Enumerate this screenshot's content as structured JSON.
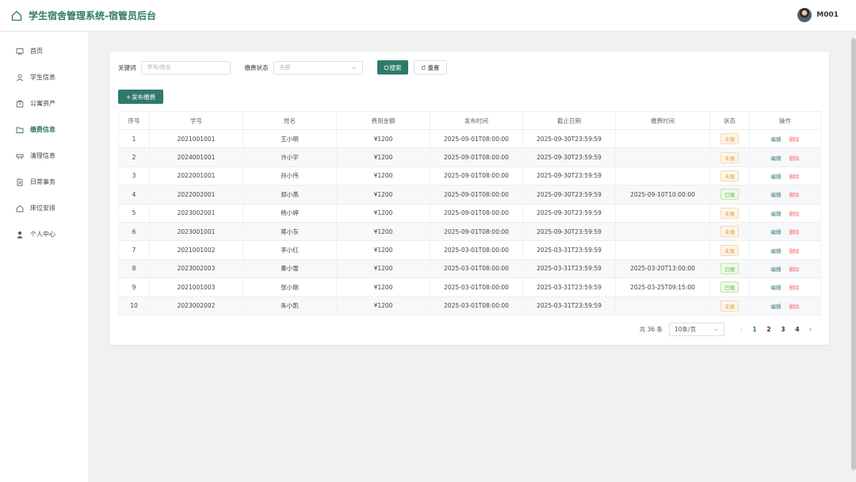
{
  "header": {
    "title": "学生宿舍管理系统-宿管员后台",
    "username": "M001"
  },
  "sidebar": {
    "items": [
      {
        "label": "首页",
        "icon": "home-board-icon"
      },
      {
        "label": "学生信息",
        "icon": "user-icon"
      },
      {
        "label": "公寓资产",
        "icon": "box-icon"
      },
      {
        "label": "缴费信息",
        "icon": "folder-icon",
        "active": true
      },
      {
        "label": "清理信息",
        "icon": "clean-icon"
      },
      {
        "label": "日常事务",
        "icon": "document-icon"
      },
      {
        "label": "床位安排",
        "icon": "house-icon"
      },
      {
        "label": "个人中心",
        "icon": "person-icon"
      }
    ]
  },
  "filters": {
    "keyword_label": "关键词",
    "keyword_placeholder": "学号/姓名",
    "status_label": "缴费状态",
    "status_value": "全部",
    "search_label": "搜索",
    "reset_label": "重置"
  },
  "add_button": "发布缴费",
  "table": {
    "headers": [
      "序号",
      "学号",
      "姓名",
      "费用金额",
      "发布时间",
      "截止日期",
      "缴费时间",
      "状态",
      "操作"
    ],
    "edit_label": "编辑",
    "delete_label": "删除",
    "rows": [
      {
        "no": "1",
        "sid": "2021001001",
        "name": "王小明",
        "amount": "¥1200",
        "published": "2025-09-01T08:00:00",
        "deadline": "2025-09-30T23:59:59",
        "paid_at": "",
        "status": "未缴",
        "paid": false
      },
      {
        "no": "2",
        "sid": "2024001001",
        "name": "许小宇",
        "amount": "¥1200",
        "published": "2025-09-01T08:00:00",
        "deadline": "2025-09-30T23:59:59",
        "paid_at": "",
        "status": "未缴",
        "paid": false
      },
      {
        "no": "3",
        "sid": "2022001001",
        "name": "孙小伟",
        "amount": "¥1200",
        "published": "2025-09-01T08:00:00",
        "deadline": "2025-09-30T23:59:59",
        "paid_at": "",
        "status": "未缴",
        "paid": false
      },
      {
        "no": "4",
        "sid": "2022002001",
        "name": "郑小燕",
        "amount": "¥1200",
        "published": "2025-09-01T08:00:00",
        "deadline": "2025-09-30T23:59:59",
        "paid_at": "2025-09-10T10:00:00",
        "status": "已缴",
        "paid": true
      },
      {
        "no": "5",
        "sid": "2023002001",
        "name": "杨小婷",
        "amount": "¥1200",
        "published": "2025-09-01T08:00:00",
        "deadline": "2025-09-30T23:59:59",
        "paid_at": "",
        "status": "未缴",
        "paid": false
      },
      {
        "no": "6",
        "sid": "2023001001",
        "name": "蒋小东",
        "amount": "¥1200",
        "published": "2025-09-01T08:00:00",
        "deadline": "2025-09-30T23:59:59",
        "paid_at": "",
        "status": "未缴",
        "paid": false
      },
      {
        "no": "7",
        "sid": "2021001002",
        "name": "李小红",
        "amount": "¥1200",
        "published": "2025-03-01T08:00:00",
        "deadline": "2025-03-31T23:59:59",
        "paid_at": "",
        "status": "未缴",
        "paid": false
      },
      {
        "no": "8",
        "sid": "2023002003",
        "name": "秦小雪",
        "amount": "¥1200",
        "published": "2025-03-01T08:00:00",
        "deadline": "2025-03-31T23:59:59",
        "paid_at": "2025-03-20T13:00:00",
        "status": "已缴",
        "paid": true
      },
      {
        "no": "9",
        "sid": "2021001003",
        "name": "张小刚",
        "amount": "¥1200",
        "published": "2025-03-01T08:00:00",
        "deadline": "2025-03-31T23:59:59",
        "paid_at": "2025-03-25T09:15:00",
        "status": "已缴",
        "paid": true
      },
      {
        "no": "10",
        "sid": "2023002002",
        "name": "朱小凯",
        "amount": "¥1200",
        "published": "2025-03-01T08:00:00",
        "deadline": "2025-03-31T23:59:59",
        "paid_at": "",
        "status": "未缴",
        "paid": false
      }
    ]
  },
  "pagination": {
    "total": "共 36 条",
    "page_size": "10条/页",
    "pages": [
      "1",
      "2",
      "3",
      "4"
    ],
    "current": "1"
  },
  "colors": {
    "accent": "#2f7a6b",
    "unpaid": "#e6a23c",
    "paid": "#67c23a",
    "delete": "#f56c6c"
  }
}
